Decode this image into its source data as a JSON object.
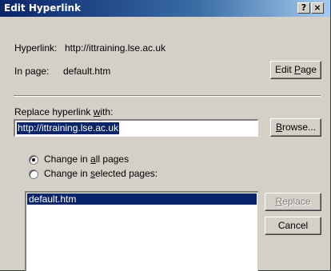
{
  "window": {
    "title": "Edit Hyperlink",
    "help_button": "?",
    "close_button": "×"
  },
  "hyperlink": {
    "label": "Hyperlink:",
    "value": "http://ittraining.lse.ac.uk"
  },
  "in_page": {
    "label": "In page:",
    "value": "default.htm"
  },
  "edit_page_button": {
    "pre": "Edit ",
    "accel": "P",
    "post": "age"
  },
  "replace_with": {
    "label_pre": "Replace hyperlink ",
    "label_accel": "w",
    "label_post": "ith:",
    "value": "http://ittraining.lse.ac.uk"
  },
  "browse_button": {
    "pre": "",
    "accel": "B",
    "post": "rowse..."
  },
  "scope": {
    "all_pages": {
      "pre": "Change in ",
      "accel": "a",
      "post": "ll pages",
      "checked": true
    },
    "selected_pages": {
      "pre": "Change in ",
      "accel": "s",
      "post": "elected pages:",
      "checked": false
    }
  },
  "pages_list": {
    "items": [
      "default.htm"
    ],
    "selected_index": 0
  },
  "replace_button": {
    "pre": "",
    "accel": "R",
    "post": "eplace",
    "enabled": false
  },
  "cancel_button": {
    "label": "Cancel"
  }
}
